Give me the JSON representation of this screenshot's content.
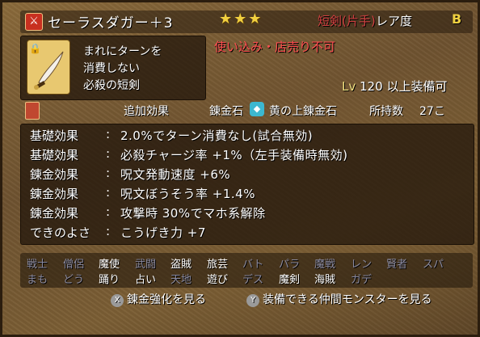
{
  "header": {
    "item_name": "セーラスダガー＋3",
    "stars": "★★★",
    "category": "短剣(片手)",
    "rarity_label": "レア度",
    "rarity_grade": "B"
  },
  "description": {
    "lines": [
      "まれにターンを",
      "消費しない",
      "必殺の短剣"
    ]
  },
  "restriction": "使い込み・店売り不可",
  "level_req": {
    "prefix": "Lv",
    "level": "120",
    "suffix": "以上装備可"
  },
  "alchemy": {
    "added_effects_label": "追加効果",
    "stone_label": "錬金石",
    "stone_icon": "gem-icon",
    "stone_name": "黄の上錬金石",
    "owned_label": "所持数",
    "owned_count": "27こ"
  },
  "effects": [
    {
      "label": "基礎効果",
      "value": "2.0%でターン消費なし(試合無効)"
    },
    {
      "label": "基礎効果",
      "value": "必殺チャージ率 +1%（左手装備時無効)"
    },
    {
      "label": "錬金効果",
      "value": "呪文発動速度 +6%"
    },
    {
      "label": "錬金効果",
      "value": "呪文ぼうそう率 +1.4%"
    },
    {
      "label": "錬金効果",
      "value": "攻撃時 30%でマホ系解除"
    },
    {
      "label": "できのよさ",
      "value": "こうげき力 +7"
    }
  ],
  "effect_colon": ":",
  "jobs_row1": [
    {
      "name": "戦士",
      "on": false
    },
    {
      "name": "僧侶",
      "on": false
    },
    {
      "name": "魔使",
      "on": true
    },
    {
      "name": "武闘",
      "on": false
    },
    {
      "name": "盗賊",
      "on": true
    },
    {
      "name": "旅芸",
      "on": true
    },
    {
      "name": "バト",
      "on": false
    },
    {
      "name": "パラ",
      "on": false
    },
    {
      "name": "魔戦",
      "on": false
    },
    {
      "name": "レン",
      "on": false
    },
    {
      "name": "賢者",
      "on": false
    },
    {
      "name": "スパ",
      "on": false
    }
  ],
  "jobs_row2": [
    {
      "name": "まも",
      "on": false
    },
    {
      "name": "どう",
      "on": false
    },
    {
      "name": "踊り",
      "on": true
    },
    {
      "name": "占い",
      "on": true
    },
    {
      "name": "天地",
      "on": false
    },
    {
      "name": "遊び",
      "on": true
    },
    {
      "name": "デス",
      "on": false
    },
    {
      "name": "魔剣",
      "on": true
    },
    {
      "name": "海賊",
      "on": true
    },
    {
      "name": "ガデ",
      "on": false
    }
  ],
  "buttons": {
    "x_badge": "X",
    "x_label": "錬金強化を見る",
    "y_badge": "Y",
    "y_label": "装備できる仲間モンスターを見る"
  },
  "colors": {
    "job_on": "#ffffff",
    "job_off": "#8a8aa0",
    "restriction": "#ff5050",
    "category": "#d04040"
  }
}
